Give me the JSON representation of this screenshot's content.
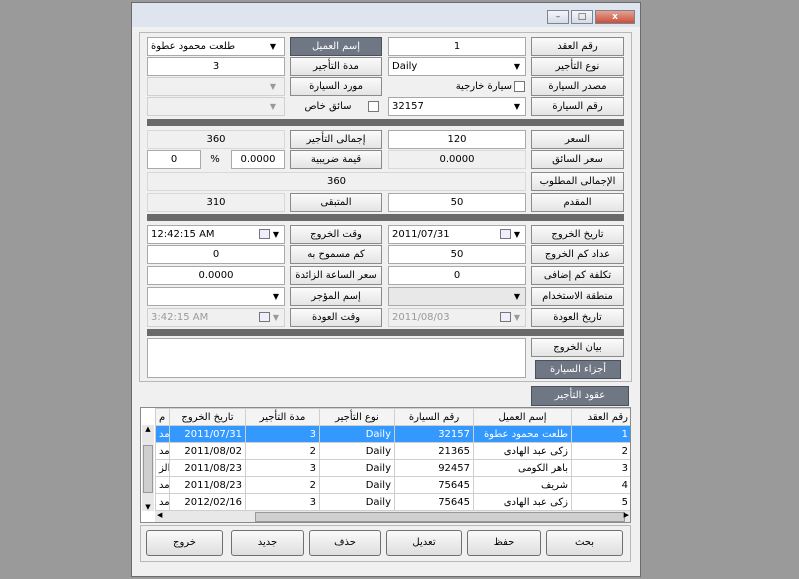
{
  "window": {
    "minimize": "–",
    "maximize": "□",
    "close": "x"
  },
  "form": {
    "contract_no_label": "رقم العقد",
    "contract_no": "1",
    "rental_type_label": "نوع التأجير",
    "rental_type": "Daily",
    "car_source_label": "مصدر السيارة",
    "external_car_label": "سيارة خارجية",
    "car_no_label": "رقم السيارة",
    "car_no": "32157",
    "customer_label": "إسم العميل",
    "customer": "طلعت محمود عطوة",
    "rental_period_label": "مدة التأجير",
    "rental_period": "3",
    "car_supplier_label": "مورد السيارة",
    "private_driver_label": "سائق خاص",
    "price_label": "السعر",
    "price": "120",
    "driver_price_label": "سعر السائق",
    "driver_price": "0.0000",
    "total_required_label": "الإجمالى المطلوب",
    "total_required": "360",
    "advance_label": "المقدم",
    "advance": "50",
    "total_rent_label": "إجمالى التأجير",
    "total_rent": "360",
    "tax_value_label": "قيمة ضريبية",
    "tax_value": "0.0000",
    "tax_percent_symbol": "%",
    "tax_percent": "0",
    "remaining_label": "المتبقى",
    "remaining": "310",
    "exit_date_label": "تاريخ الخروج",
    "exit_date": "2011/07/31",
    "exit_km_label": "عداد كم الخروج",
    "exit_km": "50",
    "extra_km_cost_label": "تكلفة كم إضافى",
    "extra_km_cost": "0",
    "usage_area_label": "منطقة الاستخدام",
    "return_date_label": "تاريخ العودة",
    "return_date": "2011/08/03",
    "exit_time_label": "وقت الخروج",
    "exit_time": "12:42:15 AM",
    "allowed_km_label": "كم مسموح به",
    "allowed_km": "0",
    "extra_hour_price_label": "سعر الساعة الزائدة",
    "extra_hour_price": "0.0000",
    "lessor_name_label": "إسم المؤجر",
    "return_time_label": "وقت العودة",
    "return_time": "3:42:15 AM",
    "exit_statement_label": "بيان الخروج",
    "car_parts_label": "أجزاء السيارة"
  },
  "grid": {
    "section_title": "عقود التأجير",
    "columns": [
      "رقم العقد",
      "إسم العميل",
      "رقم السيارة",
      "نوع التأجير",
      "مدة التأجير",
      "تاريخ الخروج",
      "م"
    ],
    "rows": [
      [
        "1",
        "طلعت محمود عطوة",
        "32157",
        "Daily",
        "3",
        "2011/07/31",
        "مد"
      ],
      [
        "2",
        "زكى عبد الهادى",
        "21365",
        "Daily",
        "2",
        "2011/08/02",
        "مد"
      ],
      [
        "3",
        "باهر الكومى",
        "92457",
        "Daily",
        "3",
        "2011/08/23",
        "الز"
      ],
      [
        "4",
        "شريف",
        "75645",
        "Daily",
        "2",
        "2011/08/23",
        "مد"
      ],
      [
        "5",
        "زكى عبد الهادى",
        "75645",
        "Daily",
        "3",
        "2012/02/16",
        "مد"
      ]
    ]
  },
  "buttons": {
    "search": "بحث",
    "save": "حفظ",
    "edit": "تعديل",
    "delete": "حذف",
    "new": "جديد",
    "exit": "خروج"
  }
}
